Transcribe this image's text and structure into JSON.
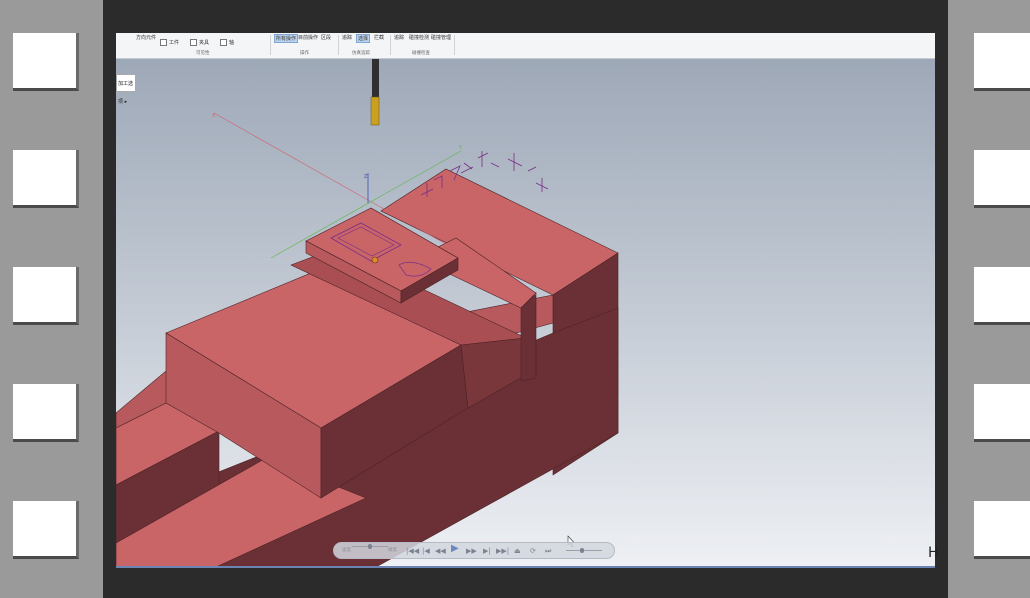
{
  "ribbon": {
    "items": [
      "方向元件",
      "工件",
      "夹具",
      "轴",
      "所有操作",
      "目前操作",
      "区段",
      "追踪",
      "选择",
      "拦截",
      "追踪",
      "碰撞检测",
      "碰撞管理"
    ],
    "groups": [
      "可见性",
      "操作",
      "仿真追踪",
      "碰撞检查"
    ],
    "active_index": 4
  },
  "viewport": {
    "popup_label": "加工选项 ▸",
    "part_engraving": "模具2年上模板下",
    "axis_labels": [
      "Z",
      "Y",
      "X"
    ]
  },
  "player": {
    "speed_label": "速度",
    "quality_label": "精度",
    "buttons": [
      "|◀◀",
      "|◀",
      "◀◀",
      "▶",
      "▶▶",
      "▶|",
      "▶▶|",
      "⏏",
      "⟳",
      "⏭"
    ]
  },
  "overlay_char": "H",
  "colors": {
    "part_top": "#c96467",
    "part_side_light": "#b85a5d",
    "part_side_dark": "#6b3035"
  }
}
